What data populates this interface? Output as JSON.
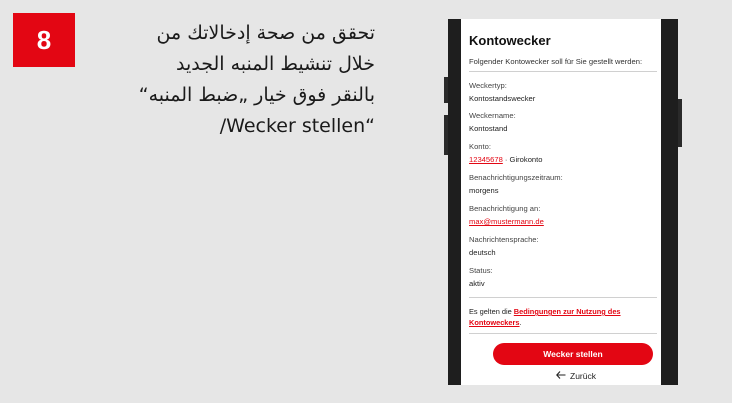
{
  "step": {
    "number": "8",
    "color": "#e30613"
  },
  "instruction": {
    "lines": [
      "تحقق من صحة إدخالاتك من",
      "خلال تنشيط المنبه الجديد",
      "بالنقر فوق خيار „ضبط المنبه“",
      "“Wecker stellen/"
    ]
  },
  "screen": {
    "title": "Kontowecker",
    "subtitle": "Folgender Kontowecker soll für Sie gestellt werden:",
    "fields": {
      "type": {
        "label": "Weckertyp:",
        "value": "Kontostandswecker"
      },
      "name": {
        "label": "Weckername:",
        "value": "Kontostand"
      },
      "account": {
        "label": "Konto:",
        "number": "12345678",
        "rest": " · Girokonto"
      },
      "period": {
        "label": "Benachrichtigungszeitraum:",
        "value": "morgens"
      },
      "notify": {
        "label": "Benachrichtigung an:",
        "value": "max@mustermann.de"
      },
      "language": {
        "label": "Nachrichtensprache:",
        "value": "deutsch"
      },
      "status": {
        "label": "Status:",
        "value": "aktiv"
      }
    },
    "terms": {
      "prefix": "Es gelten die ",
      "link": "Bedingungen zur Nutzung des Kontoweckers",
      "suffix": "."
    },
    "primary_button": "Wecker stellen",
    "back_link": "Zurück",
    "back_icon": "arrow-left-icon"
  }
}
